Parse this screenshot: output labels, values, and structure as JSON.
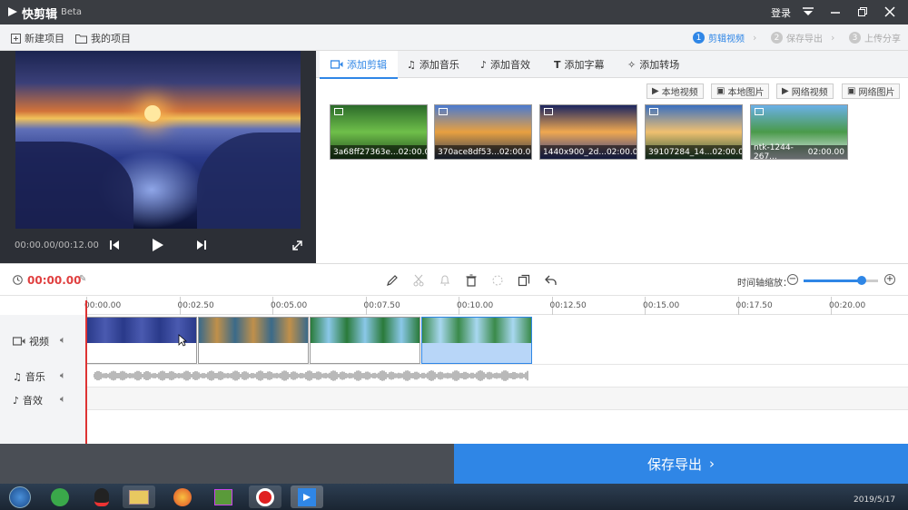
{
  "app": {
    "title": "快剪辑",
    "badge": "Beta",
    "login": "登录"
  },
  "toolbar": {
    "new_project": "新建项目",
    "my_projects": "我的项目"
  },
  "steps": [
    {
      "num": "1",
      "label": "剪辑视频",
      "active": true
    },
    {
      "num": "2",
      "label": "保存导出",
      "active": false
    },
    {
      "num": "3",
      "label": "上传分享",
      "active": false
    }
  ],
  "preview": {
    "time": "00:00.00/00:12.00"
  },
  "tabs": [
    {
      "label": "添加剪辑",
      "icon": "video-camera-icon",
      "active": true
    },
    {
      "label": "添加音乐",
      "icon": "music-note-icon",
      "active": false
    },
    {
      "label": "添加音效",
      "icon": "sound-effect-icon",
      "active": false
    },
    {
      "label": "添加字幕",
      "icon": "text-t-icon",
      "active": false
    },
    {
      "label": "添加转场",
      "icon": "transition-icon",
      "active": false
    }
  ],
  "sources": [
    "本地视频",
    "本地图片",
    "网络视频",
    "网络图片"
  ],
  "media": [
    {
      "name": "3a68ff27363e...",
      "duration": "02:00.00",
      "colors": [
        "#2b6a2a",
        "#6fbf4a",
        "#1f4a1c"
      ]
    },
    {
      "name": "370ace8df53...",
      "duration": "02:00.00",
      "colors": [
        "#4a7ad0",
        "#e8a040",
        "#2a3a55"
      ]
    },
    {
      "name": "1440x900_2d...",
      "duration": "02:00.00",
      "colors": [
        "#1b2560",
        "#f0a850",
        "#2a3a8a"
      ]
    },
    {
      "name": "39107284_14...",
      "duration": "02:00.00",
      "colors": [
        "#3a70c0",
        "#f0c070",
        "#2a5a3a"
      ]
    },
    {
      "name": "ntk-1244-267...",
      "duration": "02:00.00",
      "colors": [
        "#6ab0e8",
        "#4a9a4a",
        "#e8f0f8"
      ]
    }
  ],
  "editbar": {
    "time": "00:00.00",
    "zoom_label": "时间轴缩放："
  },
  "ruler": [
    "00:00.00",
    "00:02.50",
    "00:05.00",
    "00:07.50",
    "00:10.00",
    "00:12.50",
    "00:15.00",
    "00:17.50",
    "00:20.00"
  ],
  "tracks": {
    "video": "视频",
    "music": "音乐",
    "sfx": "音效"
  },
  "clips": [
    {
      "colors": [
        "#2a3a8a",
        "#4a5ab0"
      ],
      "selected": false
    },
    {
      "colors": [
        "#3a6a8a",
        "#c0904a"
      ],
      "selected": false
    },
    {
      "colors": [
        "#2a7a3a",
        "#8ac8e8"
      ],
      "selected": false
    },
    {
      "colors": [
        "#3a8a4a",
        "#a8d8f0"
      ],
      "selected": true
    }
  ],
  "save_export": "保存导出",
  "taskbar": {
    "date": "2019/5/17"
  },
  "colors": {
    "accent": "#2f86e6",
    "playhead": "#dd3333"
  }
}
